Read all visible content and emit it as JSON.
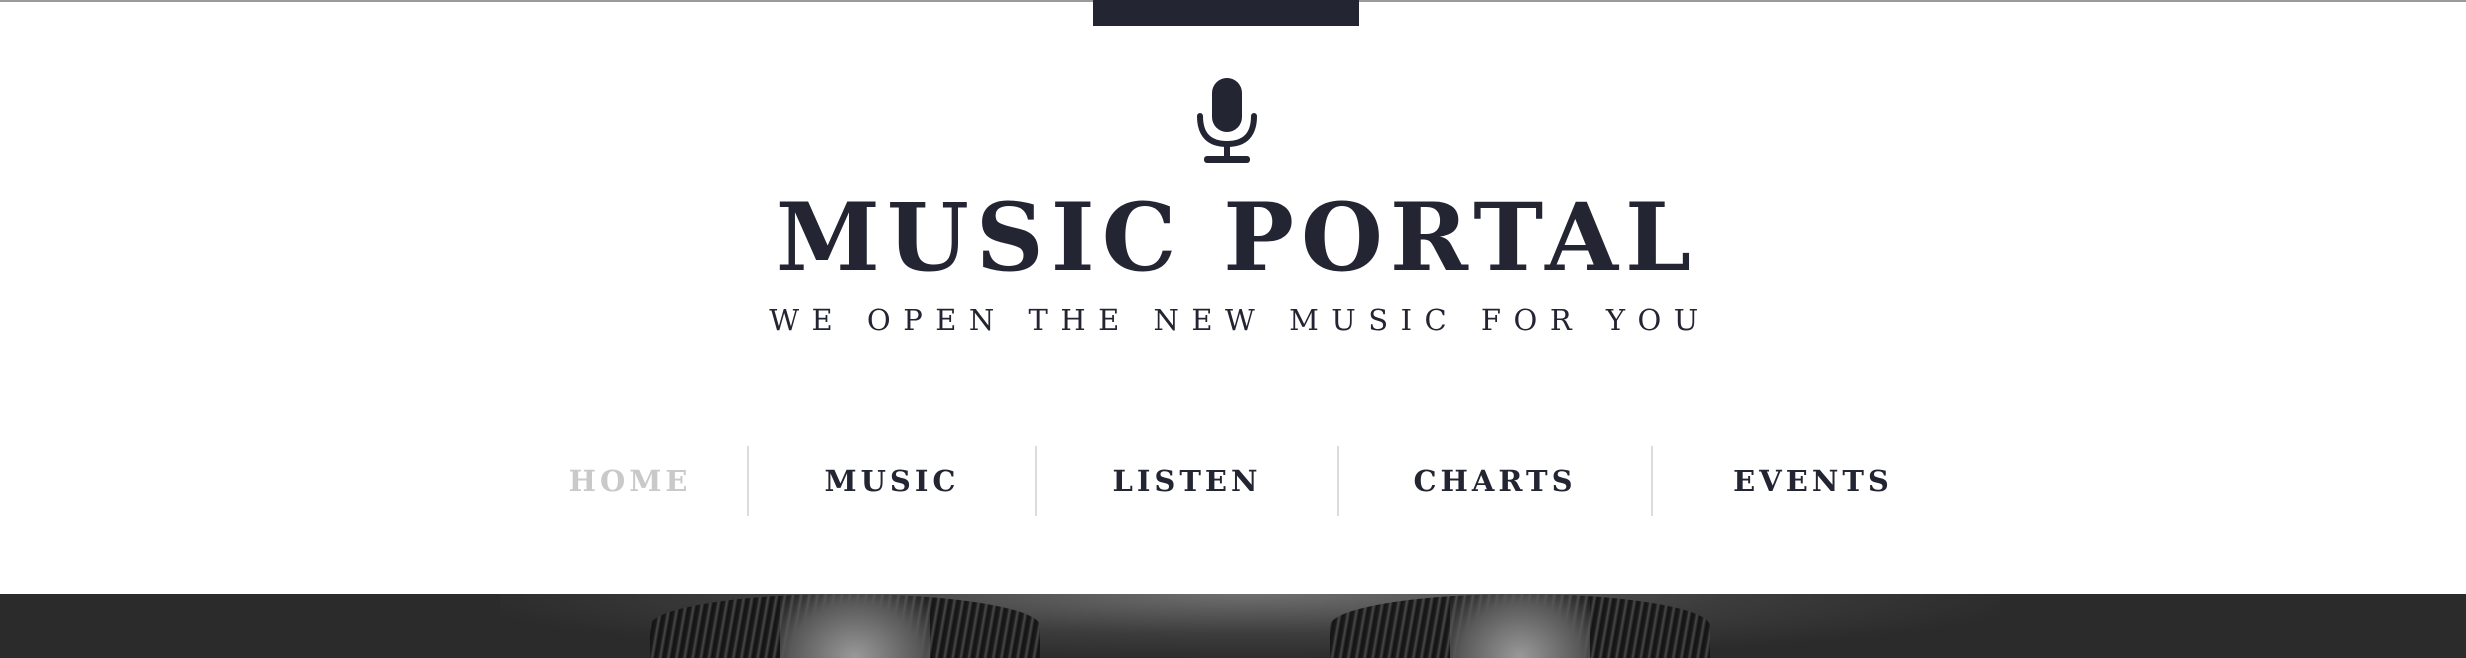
{
  "header": {
    "title": "MUSIC PORTAL",
    "tagline": "WE OPEN THE NEW MUSIC FOR YOU",
    "logo_icon": "microphone-icon"
  },
  "nav": {
    "items": [
      {
        "label": "HOME",
        "active": true
      },
      {
        "label": "MUSIC",
        "active": false
      },
      {
        "label": "LISTEN",
        "active": false
      },
      {
        "label": "CHARTS",
        "active": false
      },
      {
        "label": "EVENTS",
        "active": false
      }
    ]
  },
  "colors": {
    "primary": "#242533",
    "nav_active": "#c9c9c9",
    "divider": "#dcdcdc",
    "hero_background": "#2b2b2b"
  }
}
